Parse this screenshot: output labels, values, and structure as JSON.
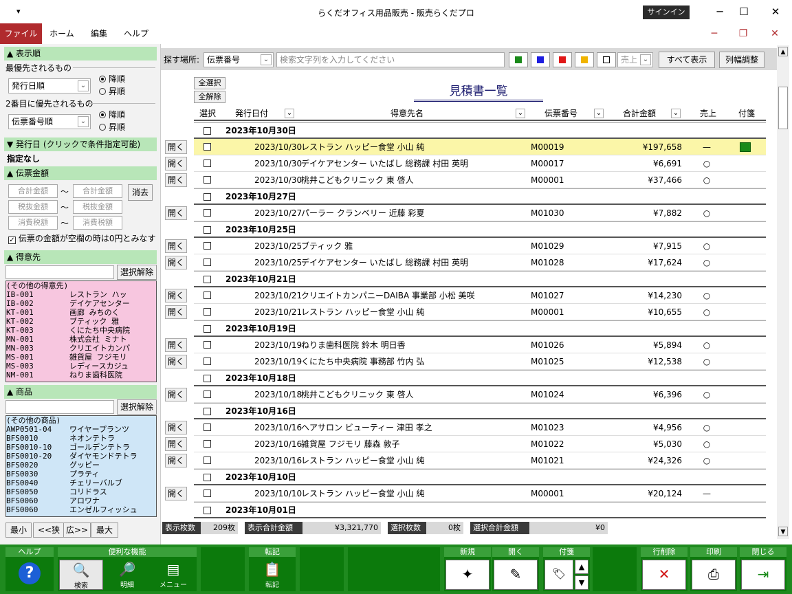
{
  "window": {
    "qat_icon": "dropdown-arrow-icon",
    "title": "らくだオフィス用品販売 - 販売らくだプロ",
    "signin": "サインイン"
  },
  "menu": {
    "file": "ファイル",
    "home": "ホーム",
    "edit": "編集",
    "help": "ヘルプ"
  },
  "left": {
    "sort_header": "▲ 表示順",
    "first_priority": "最優先されるもの",
    "first_select": "発行日順",
    "desc": "降順",
    "asc": "昇順",
    "second_priority": "2番目に優先されるもの",
    "second_select": "伝票番号順",
    "date_header": "▼ 発行日 (クリックで条件指定可能)",
    "date_none": "指定なし",
    "amount_header": "▲ 伝票金額",
    "total_amount": "合計金額",
    "pretax_amount": "税抜金額",
    "tax_amount": "消費税額",
    "tilde": "〜",
    "clear": "消去",
    "zero_check": "伝票の金額が空欄の時は0円とみなす",
    "customer_header": "▲ 得意先",
    "deselect": "選択解除",
    "customers": [
      {
        "code": "(その他の得意先)",
        "name": ""
      },
      {
        "code": "IB-001",
        "name": "レストラン ハッ"
      },
      {
        "code": "IB-002",
        "name": "デイケアセンター"
      },
      {
        "code": "KT-001",
        "name": "画廊 みちのく"
      },
      {
        "code": "KT-002",
        "name": "ブティック 雅"
      },
      {
        "code": "KT-003",
        "name": "くにたち中央病院"
      },
      {
        "code": "MN-001",
        "name": "株式会社 ミナト"
      },
      {
        "code": "MN-003",
        "name": "クリエイトカンパ"
      },
      {
        "code": "MS-001",
        "name": "雑貨屋 フジモリ"
      },
      {
        "code": "MS-003",
        "name": "レディースカジュ"
      },
      {
        "code": "NM-001",
        "name": "ねりま歯科医院"
      }
    ],
    "product_header": "▲ 商品",
    "products": [
      {
        "code": "(その他の商品)",
        "name": ""
      },
      {
        "code": "AWP0501-04",
        "name": "ワイヤープランツ"
      },
      {
        "code": "BFS0010",
        "name": "ネオンテトラ"
      },
      {
        "code": "BFS0010-10",
        "name": "ゴールデンテトラ"
      },
      {
        "code": "BFS0010-20",
        "name": "ダイヤモンドテトラ"
      },
      {
        "code": "BFS0020",
        "name": "グッピー"
      },
      {
        "code": "BFS0030",
        "name": "プラティ"
      },
      {
        "code": "BFS0040",
        "name": "チェリーバルブ"
      },
      {
        "code": "BFS0050",
        "name": "コリドラス"
      },
      {
        "code": "BFS0060",
        "name": "アロワナ"
      },
      {
        "code": "BFS0060",
        "name": "エンゼルフィッシュ"
      }
    ],
    "nav": {
      "min": "最小",
      "narrow": "<<狭",
      "wide": "広>>",
      "max": "最大"
    }
  },
  "toolbar": {
    "search_place_label": "探す場所:",
    "search_field": "伝票番号",
    "search_placeholder": "検索文字列を入力してください",
    "colors": [
      "#1a8a1a",
      "#1d1de0",
      "#e01818",
      "#f0b400"
    ],
    "sales_filter": "売上",
    "show_all": "すべて表示",
    "col_width": "列幅調整"
  },
  "list": {
    "select_all": "全選択",
    "deselect_all": "全解除",
    "title": "見積書一覧",
    "open": "開く",
    "headers": {
      "select": "選択",
      "date": "発行日付",
      "customer": "得意先名",
      "number": "伝票番号",
      "total": "合計金額",
      "sales": "売上",
      "tag": "付箋"
    },
    "groups": [
      {
        "date": "2023年10月30日",
        "rows": [
          {
            "date": "2023/10/30",
            "customer": "レストラン ハッピー食堂 小山 純",
            "number": "M00019",
            "amount": "¥197,658",
            "sales": "—",
            "tag": "green",
            "highlight": true
          },
          {
            "date": "2023/10/30",
            "customer": "デイケアセンター いたばし 総務課 村田 英明",
            "number": "M00017",
            "amount": "¥6,691",
            "sales": "○"
          },
          {
            "date": "2023/10/30",
            "customer": "桃井こどもクリニック 東 啓人",
            "number": "M00001",
            "amount": "¥37,466",
            "sales": "○"
          }
        ]
      },
      {
        "date": "2023年10月27日",
        "rows": [
          {
            "date": "2023/10/27",
            "customer": "パーラー クランベリー 近藤 彩夏",
            "number": "M01030",
            "amount": "¥7,882",
            "sales": "○"
          }
        ]
      },
      {
        "date": "2023年10月25日",
        "rows": [
          {
            "date": "2023/10/25",
            "customer": "ブティック 雅",
            "number": "M01029",
            "amount": "¥7,915",
            "sales": "○"
          },
          {
            "date": "2023/10/25",
            "customer": "デイケアセンター いたばし 総務課 村田 英明",
            "number": "M01028",
            "amount": "¥17,624",
            "sales": "○"
          }
        ]
      },
      {
        "date": "2023年10月21日",
        "rows": [
          {
            "date": "2023/10/21",
            "customer": "クリエイトカンパニーDAIBA 事業部 小松 美咲",
            "number": "M01027",
            "amount": "¥14,230",
            "sales": "○"
          },
          {
            "date": "2023/10/21",
            "customer": "レストラン ハッピー食堂 小山 純",
            "number": "M00001",
            "amount": "¥10,655",
            "sales": "○"
          }
        ]
      },
      {
        "date": "2023年10月19日",
        "rows": [
          {
            "date": "2023/10/19",
            "customer": "ねりま歯科医院 鈴木 明日香",
            "number": "M01026",
            "amount": "¥5,894",
            "sales": "○"
          },
          {
            "date": "2023/10/19",
            "customer": "くにたち中央病院 事務部 竹内 弘",
            "number": "M01025",
            "amount": "¥12,538",
            "sales": "○"
          }
        ]
      },
      {
        "date": "2023年10月18日",
        "rows": [
          {
            "date": "2023/10/18",
            "customer": "桃井こどもクリニック 東 啓人",
            "number": "M01024",
            "amount": "¥6,396",
            "sales": "○"
          }
        ]
      },
      {
        "date": "2023年10月16日",
        "rows": [
          {
            "date": "2023/10/16",
            "customer": "ヘアサロン ビューティー 津田 孝之",
            "number": "M01023",
            "amount": "¥4,956",
            "sales": "○"
          },
          {
            "date": "2023/10/16",
            "customer": "雑貨屋 フジモリ 藤森 敦子",
            "number": "M01022",
            "amount": "¥5,030",
            "sales": "○"
          },
          {
            "date": "2023/10/16",
            "customer": "レストラン ハッピー食堂 小山 純",
            "number": "M01021",
            "amount": "¥24,326",
            "sales": "○"
          }
        ]
      },
      {
        "date": "2023年10月10日",
        "rows": [
          {
            "date": "2023/10/10",
            "customer": "レストラン ハッピー食堂 小山 純",
            "number": "M00001",
            "amount": "¥20,124",
            "sales": "—"
          }
        ]
      },
      {
        "date": "2023年10月01日",
        "rows": []
      }
    ]
  },
  "status": {
    "count_label": "表示枚数",
    "count_value": "209枚",
    "total_label": "表示合計金額",
    "total_value": "¥3,321,770",
    "sel_count_label": "選択枚数",
    "sel_count_value": "0枚",
    "sel_total_label": "選択合計金額",
    "sel_total_value": "¥0"
  },
  "bottom": {
    "help_group": "ヘルプ",
    "tools_group": "便利な機能",
    "search": "検索",
    "detail": "明細",
    "menu": "メニュー",
    "post_group": "転記",
    "post": "転記",
    "new_group": "新規",
    "open_group": "開く",
    "tag_group": "付箋",
    "delete_group": "行削除",
    "print_group": "印刷",
    "close_group": "閉じる"
  }
}
